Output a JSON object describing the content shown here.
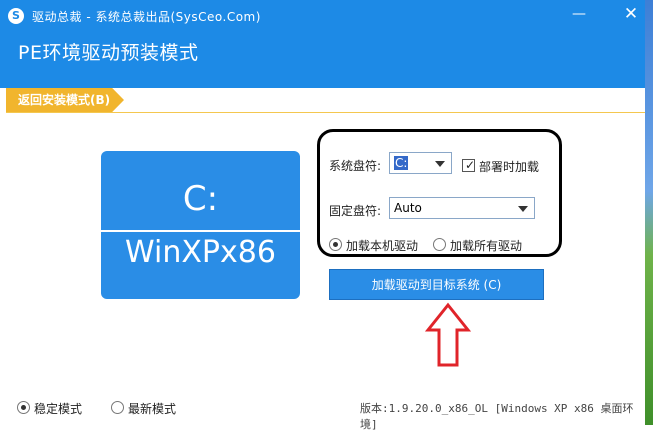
{
  "window": {
    "title": "驱动总裁 - 系统总裁出品(SysCeo.Com)",
    "minimize_glyph": "—",
    "close_glyph": "✕",
    "icon_glyph": "S"
  },
  "header": {
    "main_title": "PE环境驱动预装模式"
  },
  "back_tab": {
    "label": "返回安装模式(B)"
  },
  "drive_tile": {
    "letter": "C:",
    "os": "WinXPx86"
  },
  "options": {
    "system_drive_label": "系统盘符:",
    "system_drive_value": "C:",
    "deploy_load_label": "部署时加载",
    "deploy_load_checked": true,
    "fixed_drive_label": "固定盘符:",
    "fixed_drive_value": "Auto",
    "radio_local": "加载本机驱动",
    "radio_all": "加载所有驱动",
    "selected_radio": "local"
  },
  "actions": {
    "load_button": "加载驱动到目标系统 (C)"
  },
  "footer": {
    "mode_stable": "稳定模式",
    "mode_latest": "最新模式",
    "selected_mode": "stable",
    "version": "版本:1.9.20.0_x86_OL [Windows XP x86 桌面环境]"
  },
  "colors": {
    "title_bar": "#1d8ae6",
    "accent": "#2a8de6",
    "back_tab": "#f1b52d",
    "arrow": "#e0242a"
  }
}
